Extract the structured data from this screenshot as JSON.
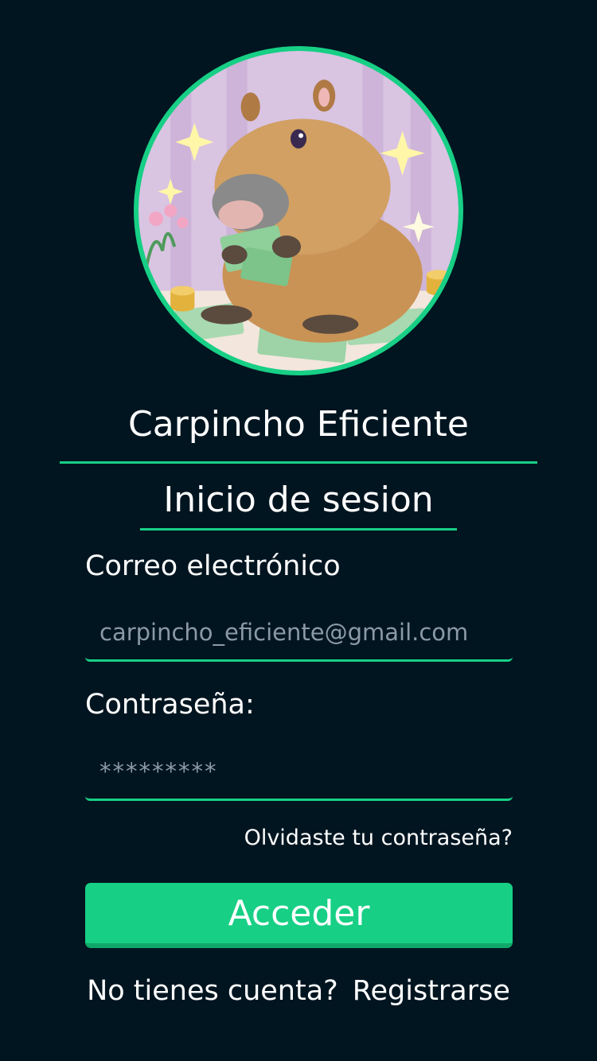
{
  "app": {
    "title": "Carpincho Eficiente",
    "subtitle": "Inicio de sesion"
  },
  "avatar": {
    "icon": "capybara-money-illustration",
    "ring_color": "#17cf85"
  },
  "form": {
    "email_label": "Correo electrónico",
    "email_value": "carpincho_eficiente@gmail.com",
    "password_label": "Contraseña:",
    "password_value": "*********",
    "forgot_label": "Olvidaste tu contraseña?",
    "submit_label": "Acceder"
  },
  "footer": {
    "prompt": "No tienes cuenta?",
    "register_label": "Registrarse"
  },
  "colors": {
    "background": "#011520",
    "accent": "#17cf85",
    "text": "#ffffff",
    "placeholder": "#8c99a6"
  }
}
